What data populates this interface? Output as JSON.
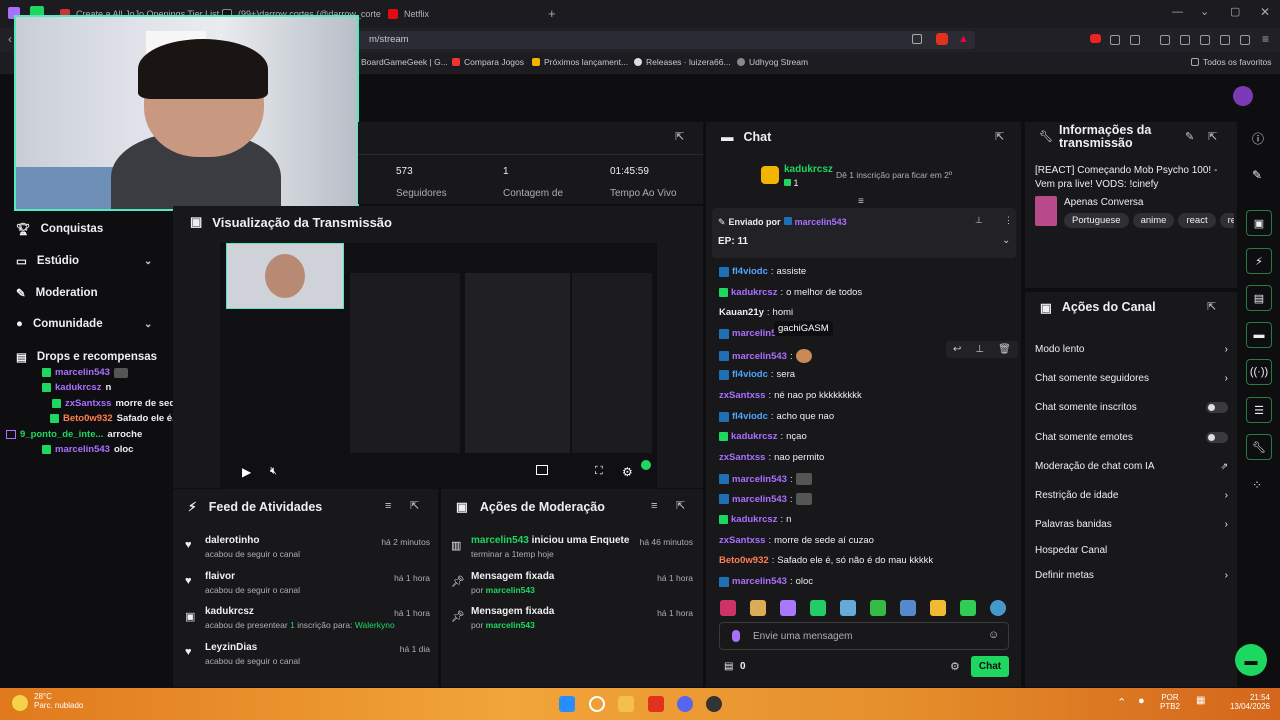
{
  "browser": {
    "tabs": [
      "Create a All JoJo Openings Tier List -",
      "(99+)darrow cortes (@darrow_corte",
      "Netflix"
    ],
    "url": "m/stream",
    "bookmarks": [
      "BoardGameGeek | G...",
      "Compara Jogos",
      "Próximos lançament...",
      "Releases · luizera66...",
      "Udhyog Stream"
    ],
    "favorites": "Todos os favoritos"
  },
  "nav": {
    "items": [
      {
        "label": "Conquistas",
        "icon": "trophy-icon"
      },
      {
        "label": "Estúdio",
        "icon": "video-icon",
        "chevron": true
      },
      {
        "label": "Moderation",
        "icon": "wrench-icon"
      },
      {
        "label": "Comunidade",
        "icon": "user-icon",
        "chevron": true
      },
      {
        "label": "Drops e recompensas",
        "icon": "gift-icon"
      }
    ]
  },
  "overlay_chat": [
    {
      "user": "marcelin543",
      "text": ""
    },
    {
      "user": "kadukrcsz",
      "text": "n"
    },
    {
      "user": "zxSantxss",
      "text": "morre de sede aí cuzao"
    },
    {
      "user": "Beto0w932",
      "text": "Safado ele é, só não é do mau kkkkk"
    },
    {
      "user": "9_ponto_de_inte...",
      "text": "arroche"
    },
    {
      "user": "marcelin543",
      "text": "oloc"
    }
  ],
  "stats": [
    {
      "value": "573",
      "label": "Seguidores"
    },
    {
      "value": "1",
      "label": "Contagem de"
    },
    {
      "value": "01:45:59",
      "label": "Tempo Ao Vivo"
    }
  ],
  "preview": {
    "title": "Visualização da Transmissão"
  },
  "feed": {
    "title": "Feed de Atividades",
    "items": [
      {
        "name": "dalerotinho",
        "sub": "acabou de seguir o canal",
        "time": "há 2 minutos",
        "icon": "heart-icon"
      },
      {
        "name": "flaivor",
        "sub": "acabou de seguir o canal",
        "time": "há 1 hora",
        "icon": "heart-icon"
      },
      {
        "name": "kadukrcsz",
        "sub": "acabou de presentear",
        "count": "1",
        "sub2": "inscrição para:",
        "target": "Walerkyno",
        "time": "há 1 hora",
        "icon": "gift-icon"
      },
      {
        "name": "LeyzinDias",
        "sub": "acabou de seguir o canal",
        "time": "há 1 dia",
        "icon": "heart-icon"
      }
    ]
  },
  "mod_actions": {
    "title": "Ações de Moderação",
    "items": [
      {
        "user": "marcelin543",
        "action": "iniciou uma Enquete",
        "sub": "terminar a 1temp hoje",
        "time": "há 46 minutos"
      },
      {
        "user": "",
        "action": "Mensagem fixada",
        "sub": "por",
        "by": "marcelin543",
        "time": "há 1 hora"
      },
      {
        "user": "",
        "action": "Mensagem fixada",
        "sub": "por",
        "by": "marcelin543",
        "time": "há 1 hora"
      }
    ]
  },
  "chat": {
    "title": "Chat",
    "top_gifter": "kadukrcsz",
    "top_gifter_count": "1",
    "gift_prompt": "Dê 1 inscrição para ficar em 2º",
    "pinned_by_label": "Enviado por",
    "pinned_user": "marcelin543",
    "pinned_text": "EP: 11",
    "tooltip": "gachiGASM",
    "messages": [
      {
        "user": "fl4viodc",
        "color": "#4ea6ff",
        "text": "assiste"
      },
      {
        "user": "kadukrcsz",
        "color": "#1ed760",
        "text": "o melhor de todos"
      },
      {
        "user": "Kauan21y",
        "color": "#a970ff",
        "text": "homi"
      },
      {
        "user": "marcelin543",
        "color": "#a970ff",
        "text": ""
      },
      {
        "user": "marcelin543",
        "color": "#a970ff",
        "text": ""
      },
      {
        "user": "fl4viodc",
        "color": "#4ea6ff",
        "text": "sera"
      },
      {
        "user": "zxSantxss",
        "color": "#a970ff",
        "text": "né nao po kkkkkkkkk"
      },
      {
        "user": "fl4viodc",
        "color": "#4ea6ff",
        "text": "acho que nao"
      },
      {
        "user": "kadukrcsz",
        "color": "#1ed760",
        "text": "nçao"
      },
      {
        "user": "zxSantxss",
        "color": "#a970ff",
        "text": "nao permito"
      },
      {
        "user": "marcelin543",
        "color": "#a970ff",
        "text": ""
      },
      {
        "user": "marcelin543",
        "color": "#a970ff",
        "text": ""
      },
      {
        "user": "kadukrcsz",
        "color": "#1ed760",
        "text": "n"
      },
      {
        "user": "zxSantxss",
        "color": "#a970ff",
        "text": "morre de sede aí cuzao"
      },
      {
        "user": "Beto0w932",
        "color": "#ff7f50",
        "text": "Safado ele é, só não é do mau kkkkk"
      },
      {
        "user": "marcelin543",
        "color": "#a970ff",
        "text": "oloc"
      }
    ],
    "input_placeholder": "Envie uma mensagem",
    "points": "0",
    "send_label": "Chat"
  },
  "info": {
    "title": "Informações da transmissão",
    "stream_title": "[REACT] Começando Mob Psycho 100! - Vem pra live! VODS: !cinefy",
    "category": "Apenas Conversa",
    "tags": [
      "Portuguese",
      "anime",
      "react",
      "re"
    ]
  },
  "channel_actions": {
    "title": "Ações do Canal",
    "rows": [
      {
        "label": "Modo lento",
        "type": "chevron"
      },
      {
        "label": "Chat somente seguidores",
        "type": "chevron"
      },
      {
        "label": "Chat somente inscritos",
        "type": "toggle"
      },
      {
        "label": "Chat somente emotes",
        "type": "toggle"
      },
      {
        "label": "Moderação de chat com IA",
        "type": "external"
      },
      {
        "label": "Restrição de idade",
        "type": "chevron"
      },
      {
        "label": "Palavras banidas",
        "type": "chevron"
      },
      {
        "label": "Hospedar Canal",
        "type": "none"
      },
      {
        "label": "Definir metas",
        "type": "chevron"
      }
    ]
  },
  "taskbar": {
    "weather_temp": "28°C",
    "weather_desc": "Parc. nublado",
    "lang": "POR",
    "lang2": "PTB2",
    "time": "21:54",
    "date": "13/04/2026"
  }
}
